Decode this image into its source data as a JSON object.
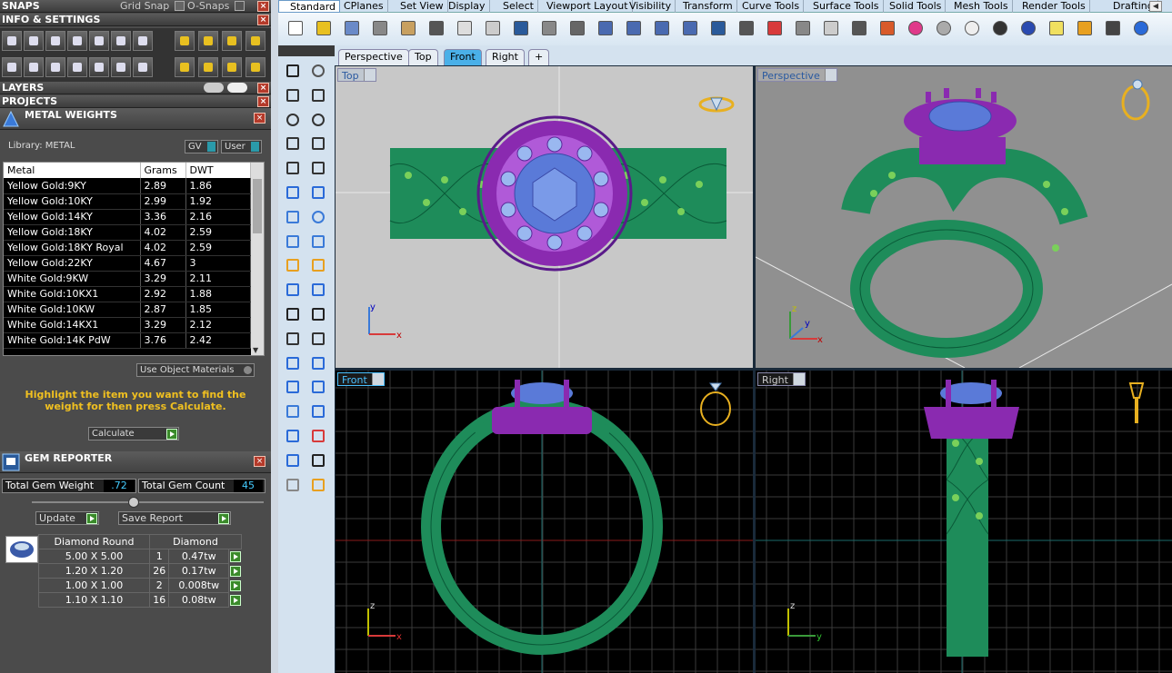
{
  "snaps": {
    "title": "SNAPS",
    "grid_snap": "Grid Snap",
    "osnaps": "O-Snaps"
  },
  "info_settings": "INFO & SETTINGS",
  "layers": "LAYERS",
  "projects": "PROJECTS",
  "metal_weights": {
    "title": "METAL WEIGHTS",
    "library": "Library: METAL",
    "gv": "GV",
    "user": "User",
    "headers": [
      "Metal",
      "Grams",
      "DWT"
    ],
    "rows": [
      [
        "Yellow Gold:9KY",
        "2.89",
        "1.86"
      ],
      [
        "Yellow Gold:10KY",
        "2.99",
        "1.92"
      ],
      [
        "Yellow Gold:14KY",
        "3.36",
        "2.16"
      ],
      [
        "Yellow Gold:18KY",
        "4.02",
        "2.59"
      ],
      [
        "Yellow Gold:18KY Royal",
        "4.02",
        "2.59"
      ],
      [
        "Yellow Gold:22KY",
        "4.67",
        "3"
      ],
      [
        "White Gold:9KW",
        "3.29",
        "2.11"
      ],
      [
        "White Gold:10KX1",
        "2.92",
        "1.88"
      ],
      [
        "White Gold:10KW",
        "2.87",
        "1.85"
      ],
      [
        "White Gold:14KX1",
        "3.29",
        "2.12"
      ],
      [
        "White Gold:14K PdW",
        "3.76",
        "2.42"
      ]
    ],
    "use_object_materials": "Use Object Materials",
    "hint": "Highlight the item you want to find the weight for then press Calculate.",
    "calculate": "Calculate"
  },
  "gem_reporter": {
    "title": "GEM REPORTER",
    "total_weight_label": "Total Gem Weight",
    "total_weight": ".72",
    "total_count_label": "Total Gem Count",
    "total_count": "45",
    "update": "Update",
    "save_report": "Save Report",
    "headers": [
      "Diamond Round",
      "Diamond"
    ],
    "rows": [
      [
        "5.00 X 5.00",
        "1",
        "0.47tw"
      ],
      [
        "1.20 X 1.20",
        "26",
        "0.17tw"
      ],
      [
        "1.00 X 1.00",
        "2",
        "0.008tw"
      ],
      [
        "1.10 X 1.10",
        "16",
        "0.08tw"
      ]
    ]
  },
  "ribbon_tabs": [
    "Standard",
    "CPlanes",
    "Set View",
    "Display",
    "Select",
    "Viewport Layout",
    "Visibility",
    "Transform",
    "Curve Tools",
    "Surface Tools",
    "Solid Tools",
    "Mesh Tools",
    "Render Tools",
    "Drafting"
  ],
  "viewport_tabs": [
    "Perspective",
    "Top",
    "Front",
    "Right",
    "+"
  ],
  "viewports": {
    "top": "Top",
    "perspective": "Perspective",
    "front": "Front",
    "right": "Right"
  },
  "axes": {
    "x": "x",
    "y": "y",
    "z": "z"
  },
  "colors": {
    "ring_green": "#1e8c5a",
    "setting_purple": "#8a2ab0",
    "stone_blue": "#5a7ad8",
    "accent_ribbon": "#cfe0f0"
  }
}
